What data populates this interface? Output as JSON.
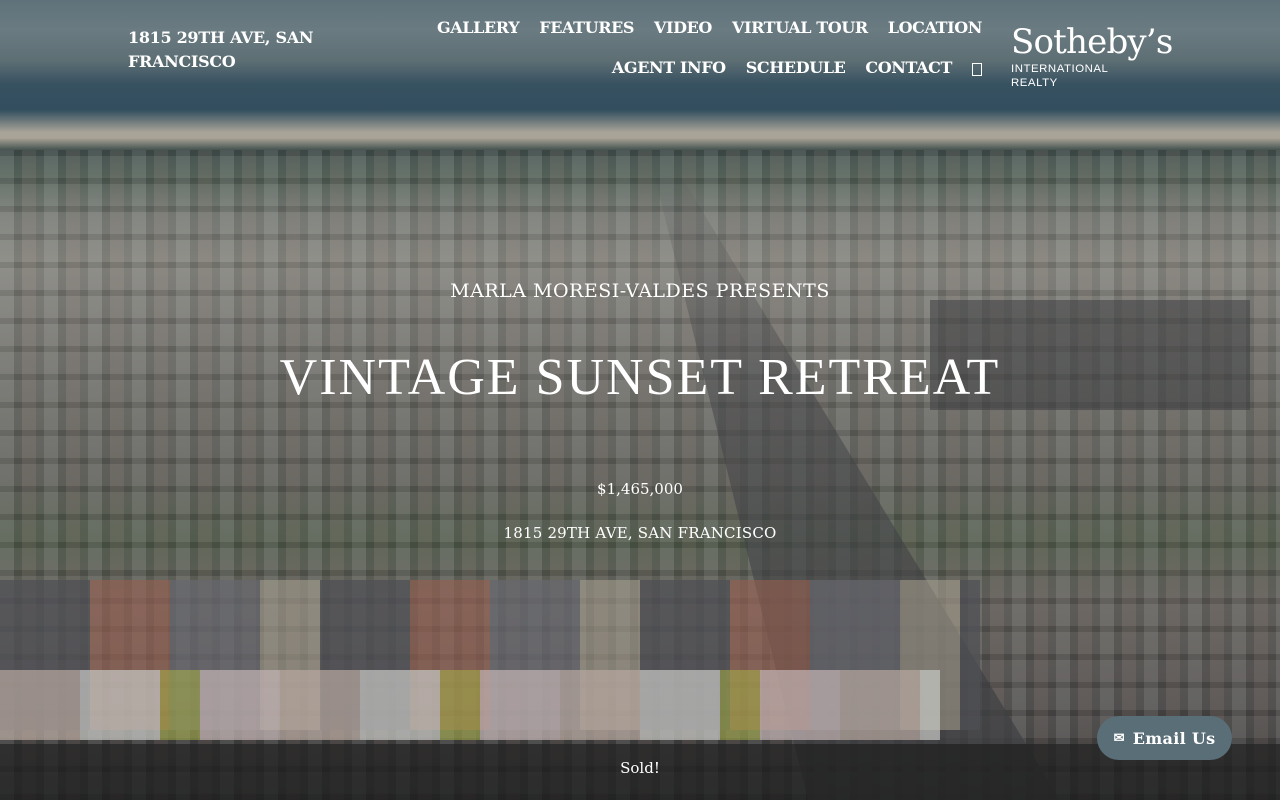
{
  "header": {
    "site_title": "1815 29TH AVE, SAN FRANCISCO",
    "nav": [
      {
        "label": "GALLERY"
      },
      {
        "label": "FEATURES"
      },
      {
        "label": "VIDEO"
      },
      {
        "label": "VIRTUAL TOUR"
      },
      {
        "label": "LOCATION"
      },
      {
        "label": "AGENT INFO"
      },
      {
        "label": "SCHEDULE"
      },
      {
        "label": "CONTACT"
      }
    ],
    "search_icon": "search-icon"
  },
  "logo": {
    "brand": "Sotheby’s",
    "tagline": "INTERNATIONAL REALTY"
  },
  "hero": {
    "presents": "MARLA MORESI-VALDES PRESENTS",
    "headline": "VINTAGE SUNSET RETREAT",
    "price": "$1,465,000",
    "address": "1815 29TH AVE, SAN FRANCISCO"
  },
  "status": {
    "text": "Sold!"
  },
  "email_button": {
    "label": "Email Us",
    "icon": "envelope-icon"
  }
}
